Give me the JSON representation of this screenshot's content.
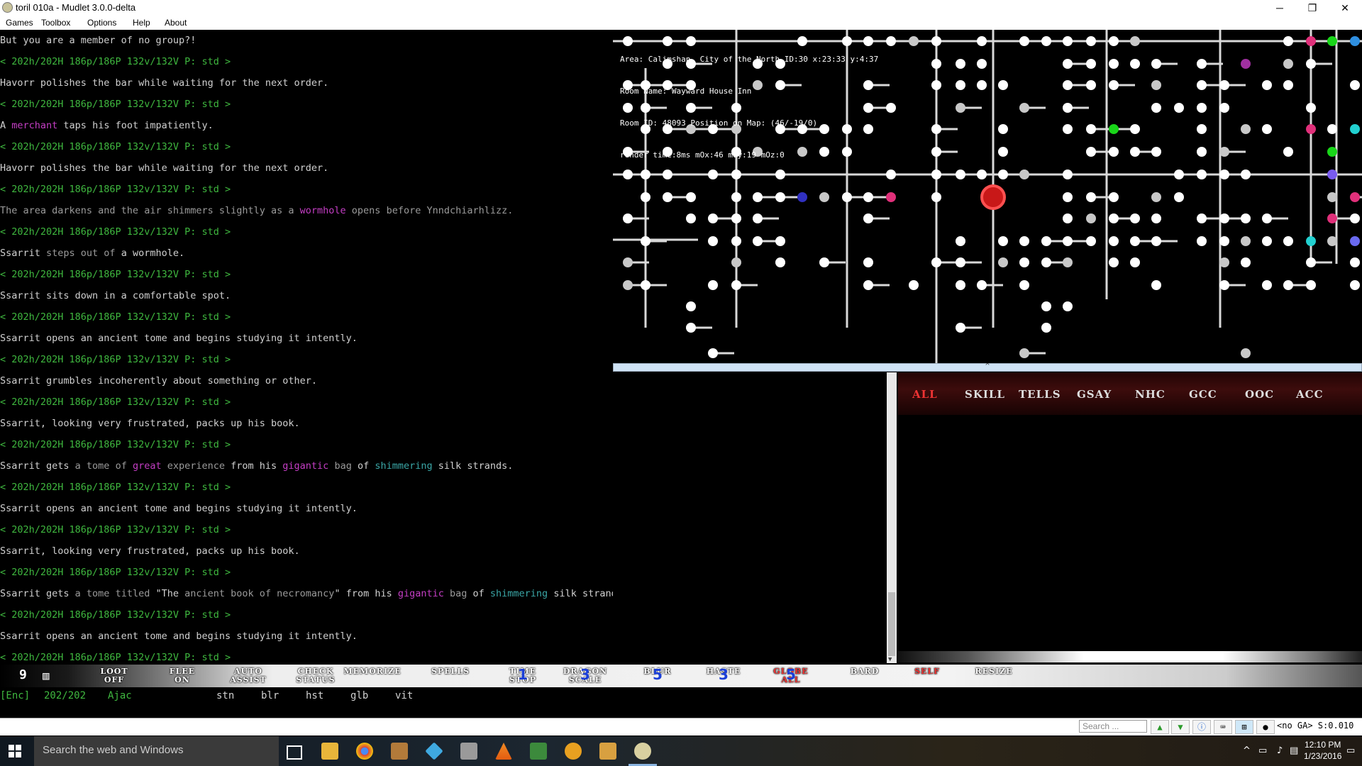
{
  "window": {
    "title": "toril 010a - Mudlet 3.0.0-delta",
    "minimize": "─",
    "maximize": "❐",
    "close": "✕"
  },
  "menu": {
    "games": "Games",
    "toolbox": "Toolbox",
    "options": "Options",
    "help": "Help",
    "about": "About"
  },
  "main_output": [
    {
      "segs": [
        {
          "t": "But you are a member of no group?!",
          "c": "w"
        }
      ]
    },
    {
      "segs": [
        {
          "t": "< 202h/202H 186p/186P 132v/132V P: std >",
          "c": "p"
        }
      ]
    },
    {
      "segs": [
        {
          "t": "Havorr polishes the bar while waiting for the next order.",
          "c": "w"
        }
      ]
    },
    {
      "segs": [
        {
          "t": "< 202h/202H 186p/186P 132v/132V P: std >",
          "c": "p"
        }
      ]
    },
    {
      "segs": [
        {
          "t": "A ",
          "c": "w"
        },
        {
          "t": "merchant",
          "c": "m"
        },
        {
          "t": " taps his foot impatiently.",
          "c": "w"
        }
      ]
    },
    {
      "segs": [
        {
          "t": "< 202h/202H 186p/186P 132v/132V P: std >",
          "c": "p"
        }
      ]
    },
    {
      "segs": [
        {
          "t": "Havorr polishes the bar while waiting for the next order.",
          "c": "w"
        }
      ]
    },
    {
      "segs": [
        {
          "t": "< 202h/202H 186p/186P 132v/132V P: std >",
          "c": "p"
        }
      ]
    },
    {
      "segs": [
        {
          "t": "The area darkens and the air shimmers slightly as a ",
          "c": "g"
        },
        {
          "t": "wormhole",
          "c": "m"
        },
        {
          "t": " opens before Ynndchiarhlizz.",
          "c": "g"
        }
      ]
    },
    {
      "segs": [
        {
          "t": "< 202h/202H 186p/186P 132v/132V P: std >",
          "c": "p"
        }
      ]
    },
    {
      "segs": [
        {
          "t": "Ssarrit ",
          "c": "w"
        },
        {
          "t": "steps out of",
          "c": "g"
        },
        {
          "t": " a wormhole.",
          "c": "w"
        }
      ]
    },
    {
      "segs": [
        {
          "t": "< 202h/202H 186p/186P 132v/132V P: std >",
          "c": "p"
        }
      ]
    },
    {
      "segs": [
        {
          "t": "Ssarrit sits down in a comfortable spot.",
          "c": "w"
        }
      ]
    },
    {
      "segs": [
        {
          "t": "< 202h/202H 186p/186P 132v/132V P: std >",
          "c": "p"
        }
      ]
    },
    {
      "segs": [
        {
          "t": "Ssarrit opens an ancient tome and begins studying it intently.",
          "c": "w"
        }
      ]
    },
    {
      "segs": [
        {
          "t": "< 202h/202H 186p/186P 132v/132V P: std >",
          "c": "p"
        }
      ]
    },
    {
      "segs": [
        {
          "t": "Ssarrit grumbles incoherently about something or other.",
          "c": "w"
        }
      ]
    },
    {
      "segs": [
        {
          "t": "< 202h/202H 186p/186P 132v/132V P: std >",
          "c": "p"
        }
      ]
    },
    {
      "segs": [
        {
          "t": "Ssarrit, looking very frustrated, packs up his book.",
          "c": "w"
        }
      ]
    },
    {
      "segs": [
        {
          "t": "< 202h/202H 186p/186P 132v/132V P: std >",
          "c": "p"
        }
      ]
    },
    {
      "segs": [
        {
          "t": "Ssarrit gets ",
          "c": "w"
        },
        {
          "t": "a tome of ",
          "c": "g"
        },
        {
          "t": "great",
          "c": "m"
        },
        {
          "t": " experience",
          "c": "g"
        },
        {
          "t": " from his ",
          "c": "w"
        },
        {
          "t": "gigantic",
          "c": "m"
        },
        {
          "t": " bag",
          "c": "g"
        },
        {
          "t": " of ",
          "c": "w"
        },
        {
          "t": "shimmering",
          "c": "c"
        },
        {
          "t": " silk strands.",
          "c": "w"
        }
      ]
    },
    {
      "segs": [
        {
          "t": "< 202h/202H 186p/186P 132v/132V P: std >",
          "c": "p"
        }
      ]
    },
    {
      "segs": [
        {
          "t": "Ssarrit opens an ancient tome and begins studying it intently.",
          "c": "w"
        }
      ]
    },
    {
      "segs": [
        {
          "t": "< 202h/202H 186p/186P 132v/132V P: std >",
          "c": "p"
        }
      ]
    },
    {
      "segs": [
        {
          "t": "Ssarrit, looking very frustrated, packs up his book.",
          "c": "w"
        }
      ]
    },
    {
      "segs": [
        {
          "t": "< 202h/202H 186p/186P 132v/132V P: std >",
          "c": "p"
        }
      ]
    },
    {
      "segs": [
        {
          "t": "Ssarrit gets ",
          "c": "w"
        },
        {
          "t": "a tome titled ",
          "c": "g"
        },
        {
          "t": "\"The ",
          "c": "w"
        },
        {
          "t": "ancient book of necromancy",
          "c": "g"
        },
        {
          "t": "\" from his ",
          "c": "w"
        },
        {
          "t": "gigantic",
          "c": "m"
        },
        {
          "t": " bag",
          "c": "g"
        },
        {
          "t": " of ",
          "c": "w"
        },
        {
          "t": "shimmering",
          "c": "c"
        },
        {
          "t": " silk strands.",
          "c": "w"
        }
      ]
    },
    {
      "segs": [
        {
          "t": "< 202h/202H 186p/186P 132v/132V P: std >",
          "c": "p"
        }
      ]
    },
    {
      "segs": [
        {
          "t": "Ssarrit opens an ancient tome and begins studying it intently.",
          "c": "w"
        }
      ]
    },
    {
      "segs": [
        {
          "t": "< 202h/202H 186p/186P 132v/132V P: std >",
          "c": "p"
        }
      ]
    }
  ],
  "map": {
    "area_line": "Area: Calimshan, City of the North ID:30 x:23:33 y:4:37",
    "room_name_line": "Room Name: Wayward House Inn",
    "room_id_line": "Room ID: 48093 Position on Map: (46/-19/0)",
    "render_line": "render time:8ms mOx:46 mOy:19 mOz:0"
  },
  "chat_tabs": [
    "ALL",
    "SKILL",
    "TELLS",
    "GSAY",
    "NHC",
    "GCC",
    "OOC",
    "ACC"
  ],
  "buttons": [
    {
      "top": "LOOT",
      "bottom": "OFF"
    },
    {
      "top": "FLEE",
      "bottom": "ON"
    },
    {
      "top": "AUTO",
      "bottom": "ASSIST"
    },
    {
      "top": "CHECK",
      "bottom": "STATUS"
    },
    {
      "top": "MEMORIZE",
      "bottom": ""
    },
    {
      "top": "SPELLS",
      "bottom": ""
    },
    {
      "top": "TIME",
      "bottom": "STOP",
      "num": "1"
    },
    {
      "top": "DRAGON",
      "bottom": "SCALE",
      "num": "3"
    },
    {
      "top": "BLUR",
      "bottom": "",
      "num": "5"
    },
    {
      "top": "HASTE",
      "bottom": "",
      "num": "3"
    },
    {
      "top": "GLOBE",
      "bottom": "ALL",
      "num": "5",
      "red": true
    },
    {
      "top": "BARD",
      "bottom": ""
    },
    {
      "top": "SELF",
      "bottom": "",
      "red": true
    },
    {
      "top": "RESIZE",
      "bottom": ""
    }
  ],
  "buttonbar_left": {
    "count": "9"
  },
  "status": {
    "enc": "[Enc]",
    "hp": "202/202",
    "name": "Ajac",
    "aff": [
      "stn",
      "blr",
      "hst",
      "glb",
      "vit"
    ]
  },
  "cmd": {
    "search_placeholder": "Search ...",
    "ga_info": "<no GA> S:0.010"
  },
  "taskbar": {
    "search_text": "Search the web and Windows",
    "time": "12:10 PM",
    "date": "1/23/2016"
  },
  "colors": {
    "prompt": "#3fb83f",
    "magenta": "#c43ec4",
    "cyan": "#3aa6a6",
    "active_tab": "#e33333"
  }
}
